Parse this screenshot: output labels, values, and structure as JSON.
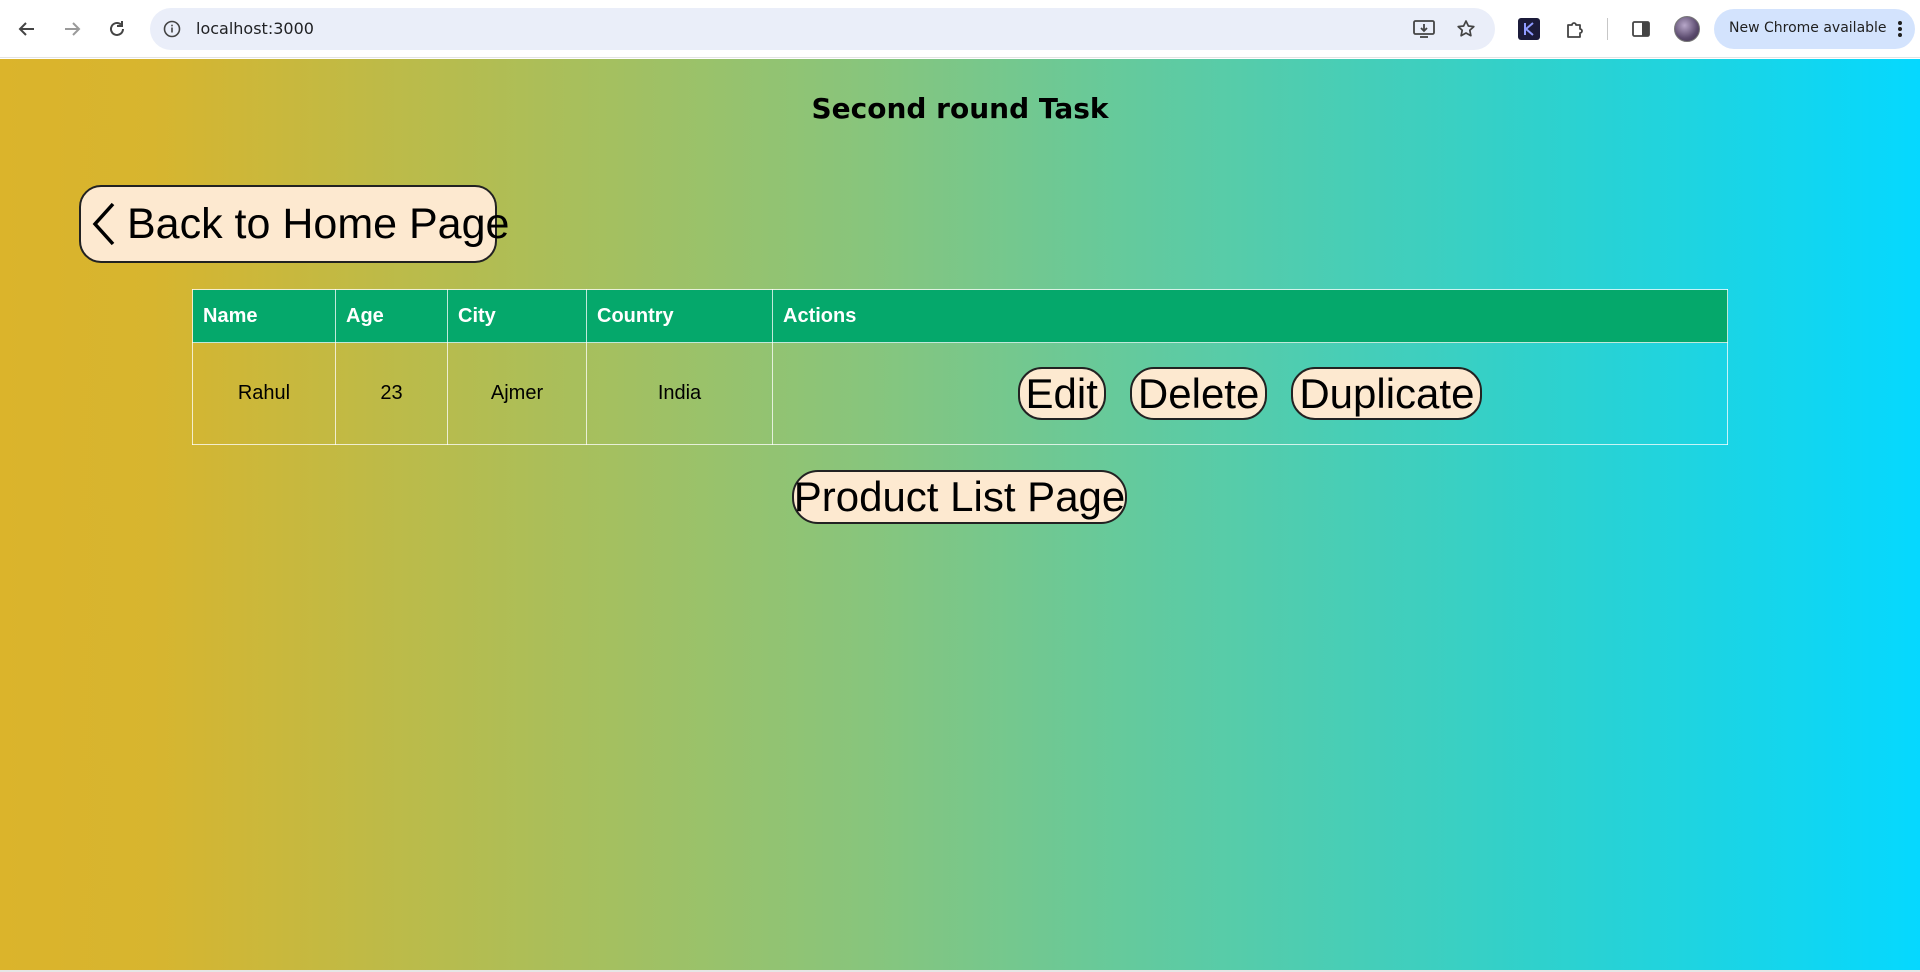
{
  "browser": {
    "url": "localhost:3000",
    "update_label": "New Chrome available"
  },
  "page": {
    "title": "Second round Task",
    "back_button_label": "Back to Home Page",
    "product_list_button_label": "Product List Page"
  },
  "table": {
    "columns": [
      "Name",
      "Age",
      "City",
      "Country",
      "Actions"
    ],
    "rows": [
      {
        "name": "Rahul",
        "age": "23",
        "city": "Ajmer",
        "country": "India"
      }
    ],
    "actions": [
      "Edit",
      "Delete",
      "Duplicate"
    ]
  },
  "colors": {
    "header_bg": "#05a86b",
    "button_bg": "#fde9d0"
  }
}
